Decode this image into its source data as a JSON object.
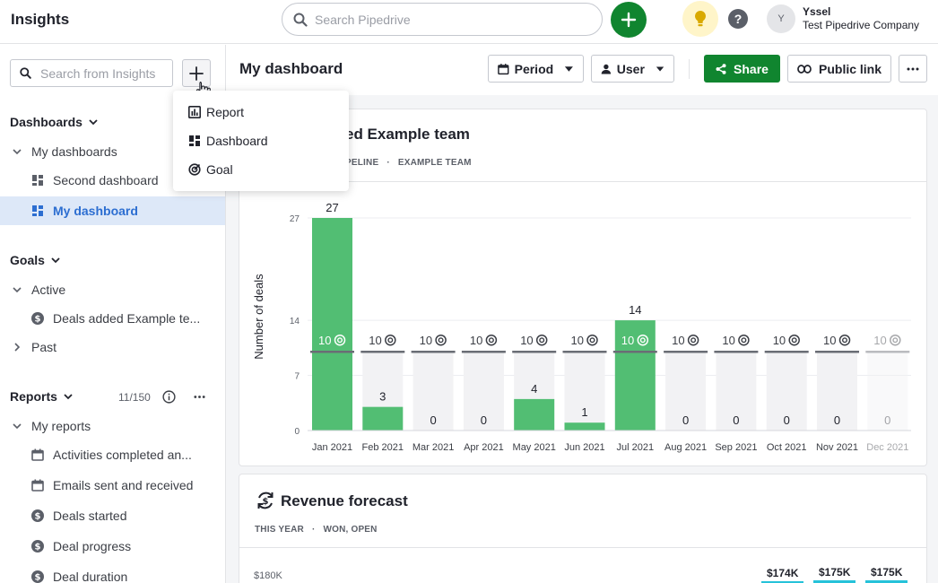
{
  "header": {
    "app_title": "Insights",
    "search_placeholder": "Search Pipedrive",
    "user": {
      "initial": "Y",
      "name": "Yssel",
      "company": "Test Pipedrive Company"
    }
  },
  "sidebar": {
    "search_placeholder": "Search from Insights",
    "dashboards": {
      "title": "Dashboards",
      "group": "My dashboards",
      "items": [
        "Second dashboard",
        "My dashboard"
      ]
    },
    "goals": {
      "title": "Goals",
      "active": "Active",
      "active_items": [
        "Deals added Example te..."
      ],
      "past": "Past"
    },
    "reports": {
      "title": "Reports",
      "count": "11/150",
      "group": "My reports",
      "items": [
        "Activities completed an...",
        "Emails sent and received",
        "Deals started",
        "Deal progress",
        "Deal duration"
      ]
    }
  },
  "add_menu": {
    "items": [
      "Report",
      "Dashboard",
      "Goal"
    ]
  },
  "main": {
    "title": "My dashboard",
    "period_label": "Period",
    "user_label": "User",
    "share_label": "Share",
    "public_link_label": "Public link"
  },
  "goal_card": {
    "title_visible": "ed Example team",
    "subtitle_visible": [
      "PELINE",
      "EXAMPLE TEAM"
    ]
  },
  "revenue_card": {
    "title": "Revenue forecast",
    "subtitle": [
      "THIS YEAR",
      "WON, OPEN"
    ],
    "y_top_label": "$180K",
    "value_labels": [
      "$174K",
      "$175K",
      "$175K"
    ]
  },
  "chart_data": [
    {
      "type": "bar",
      "ylabel": "Number of deals",
      "categories": [
        "Jan 2021",
        "Feb 2021",
        "Mar 2021",
        "Apr 2021",
        "May 2021",
        "Jun 2021",
        "Jul 2021",
        "Aug 2021",
        "Sep 2021",
        "Oct 2021",
        "Nov 2021",
        "Dec 2021"
      ],
      "values": [
        27,
        3,
        0,
        0,
        4,
        1,
        14,
        0,
        0,
        0,
        0,
        0
      ],
      "goal": 10,
      "goal_label": "10",
      "ylim": [
        0,
        27
      ],
      "yticks": [
        0,
        7,
        14,
        27
      ],
      "colors": {
        "bar": "#52be73",
        "goal_bg": "#f2f2f4",
        "goal_line": "#6a6d75"
      }
    }
  ]
}
